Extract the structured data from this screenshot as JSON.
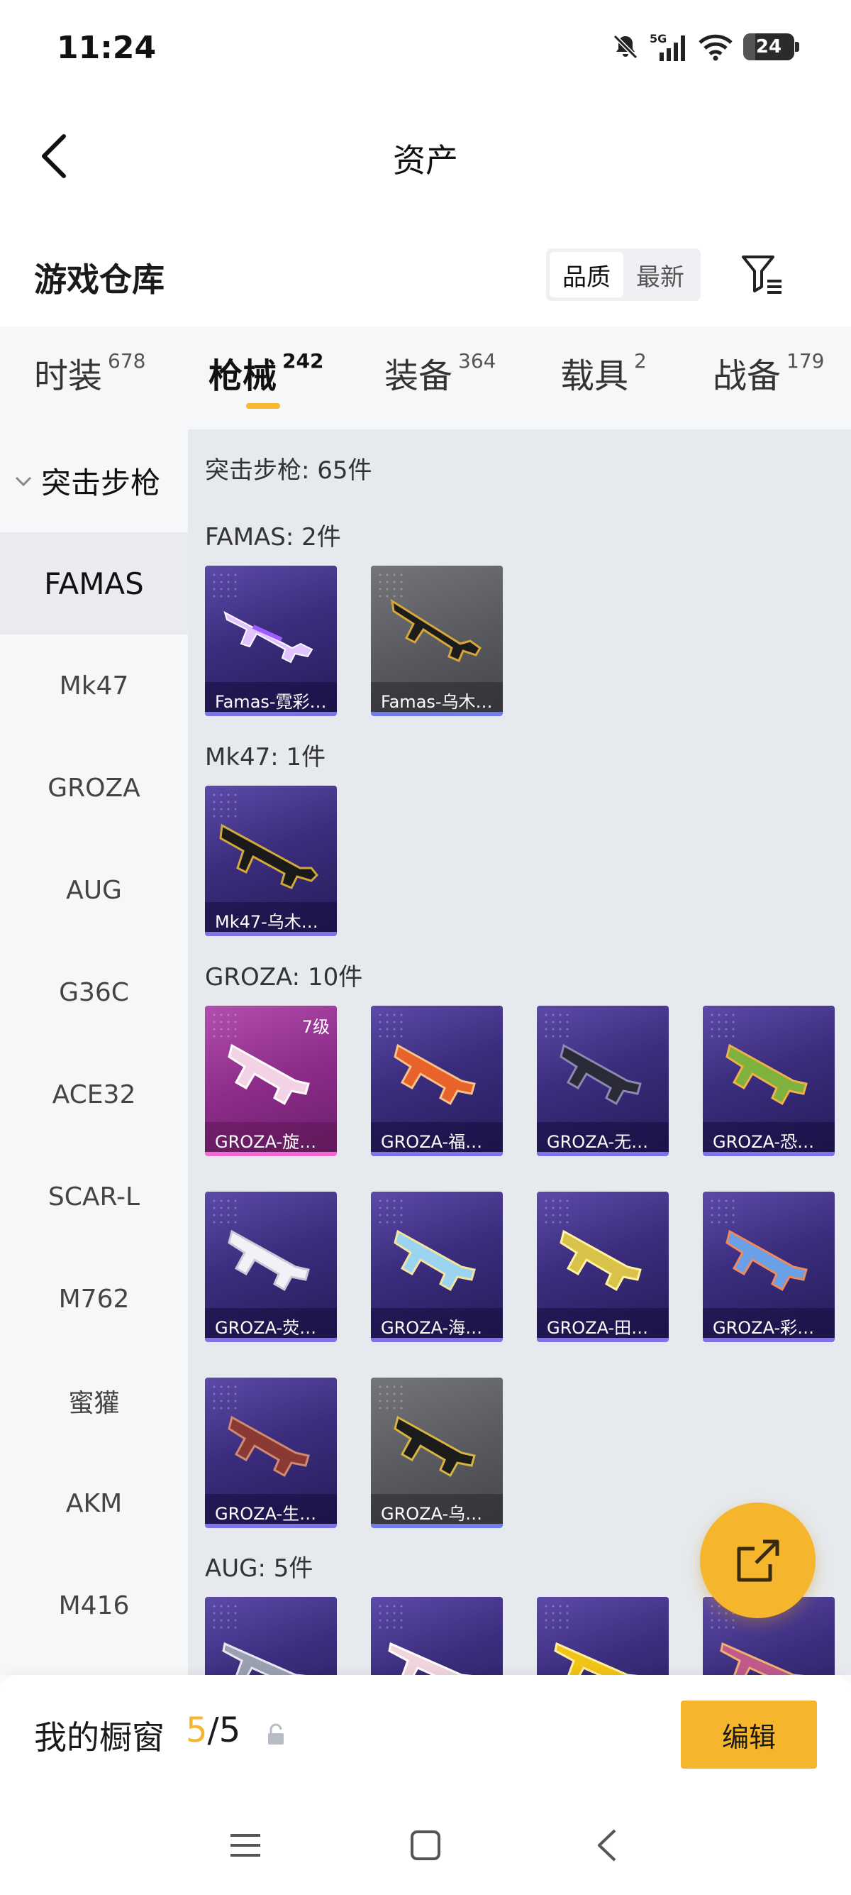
{
  "status_bar": {
    "time": "11:24",
    "battery": "24",
    "network": "5G"
  },
  "nav": {
    "title": "资产"
  },
  "warehouse": {
    "title": "游戏仓库",
    "sort_options": [
      "品质",
      "最新"
    ],
    "active_sort": "品质"
  },
  "tabs": [
    {
      "label": "时装",
      "count": "678"
    },
    {
      "label": "枪械",
      "count": "242",
      "active": true
    },
    {
      "label": "装备",
      "count": "364"
    },
    {
      "label": "载具",
      "count": "2"
    },
    {
      "label": "战备",
      "count": "179"
    }
  ],
  "sidebar": {
    "group": "突击步枪",
    "items": [
      "FAMAS",
      "Mk47",
      "GROZA",
      "AUG",
      "G36C",
      "ACE32",
      "SCAR-L",
      "M762",
      "蜜獾",
      "AKM",
      "M416"
    ],
    "active": "FAMAS"
  },
  "content": {
    "summary": "突击步枪: 65件",
    "sections": [
      {
        "title": "FAMAS: 2件",
        "items": [
          {
            "name": "Famas-霓彩…",
            "rarity": "purple"
          },
          {
            "name": "Famas-乌木…",
            "rarity": "gray"
          }
        ]
      },
      {
        "title": "Mk47: 1件",
        "items": [
          {
            "name": "Mk47-乌木…",
            "rarity": "purple"
          }
        ]
      },
      {
        "title": "GROZA: 10件",
        "items": [
          {
            "name": "GROZA-旋…",
            "rarity": "pink",
            "level": "7级"
          },
          {
            "name": "GROZA-福…",
            "rarity": "purple"
          },
          {
            "name": "GROZA-无…",
            "rarity": "purple"
          },
          {
            "name": "GROZA-恐…",
            "rarity": "purple"
          },
          {
            "name": "GROZA-荧…",
            "rarity": "purple"
          },
          {
            "name": "GROZA-海…",
            "rarity": "purple"
          },
          {
            "name": "GROZA-田…",
            "rarity": "purple"
          },
          {
            "name": "GROZA-彩…",
            "rarity": "purple"
          },
          {
            "name": "GROZA-生…",
            "rarity": "purple"
          },
          {
            "name": "GROZA-乌…",
            "rarity": "gray"
          }
        ]
      },
      {
        "title": "AUG: 5件",
        "items": []
      }
    ]
  },
  "showcase": {
    "label": "我的橱窗",
    "current": "5",
    "total": "/5",
    "edit_label": "编辑"
  },
  "colors": {
    "accent": "#f5b52d",
    "card_purple": "#3b2d7d",
    "card_gray": "#58595f",
    "card_pink": "#8e2c8a"
  },
  "icons": [
    "back-arrow-icon",
    "filter-icon",
    "share-icon",
    "lock-icon",
    "chevron-down-icon",
    "menu-icon",
    "home-icon",
    "back-icon"
  ]
}
